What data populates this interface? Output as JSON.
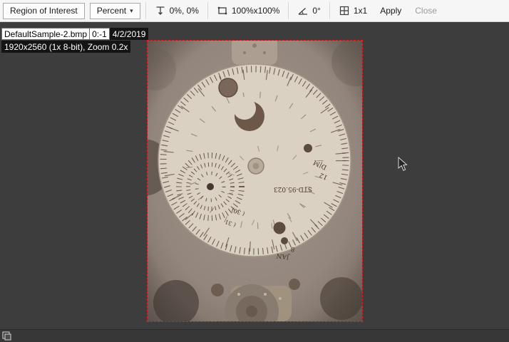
{
  "toolbar": {
    "roi_label": "Region of Interest",
    "unit_value": "Percent",
    "origin_value": "0%, 0%",
    "size_value": "100%x100%",
    "angle_value": "0°",
    "grid_value": "1x1",
    "apply_label": "Apply",
    "close_label": "Close"
  },
  "icons": {
    "chevron_down": "▾"
  },
  "overlay": {
    "filename": "DefaultSample-2.bmp",
    "frame": "0:-1",
    "date": "4/2/2019",
    "details": "1920x2560 (1x 8-bit), Zoom 0.2x"
  },
  "photo": {
    "labels": {
      "model": "STD-95.023",
      "dm": "D|M",
      "twelve": "12",
      "jan": "JAN",
      "eight": "8",
      "thirty": "( 30)",
      "thirtyone": "( 31"
    }
  },
  "colors": {
    "roi_border": "#e51c1c",
    "canvas_bg": "#3d3d3d",
    "toolbar_bg": "#f6f6f6"
  }
}
